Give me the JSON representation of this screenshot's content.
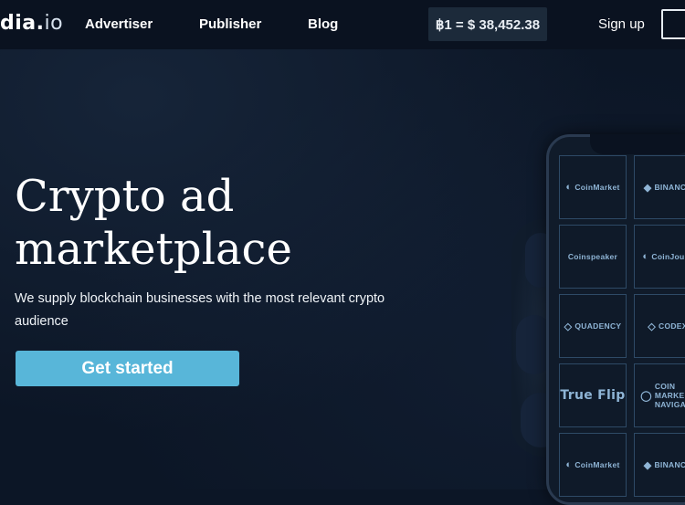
{
  "header": {
    "logo_main": "dia.",
    "logo_suffix": "io",
    "nav": [
      "Advertiser",
      "Publisher",
      "Blog"
    ],
    "price": "฿1 = $ 38,452.38",
    "signup": "Sign up"
  },
  "hero": {
    "title_line1": "Crypto ad",
    "title_line2": "marketplace",
    "subtitle": "We supply blockchain businesses with the most relevant crypto audience",
    "cta": "Get started"
  },
  "phone": {
    "tiles": [
      {
        "label": "CoinMarket",
        "icon": "coin-icon"
      },
      {
        "label": "BINANCE",
        "icon": "binance-icon"
      },
      {
        "label": "Coinspeaker",
        "icon": ""
      },
      {
        "label": "CoinJourn",
        "icon": "coin-icon"
      },
      {
        "label": "QUADENCY",
        "icon": "diamond-icon"
      },
      {
        "label": "CODEX",
        "icon": "codex-icon"
      },
      {
        "label": "True Flip",
        "icon": ""
      },
      {
        "label": "COIN MARKE NAVIGATO",
        "icon": "navigator-icon"
      },
      {
        "label": "CoinMarket",
        "icon": "coin-icon"
      },
      {
        "label": "BINANCE",
        "icon": "binance-icon"
      }
    ]
  },
  "colors": {
    "background": "#0c1626",
    "header": "#0a1220",
    "accent": "#58b6d9",
    "price_box": "#1c2a3a"
  }
}
